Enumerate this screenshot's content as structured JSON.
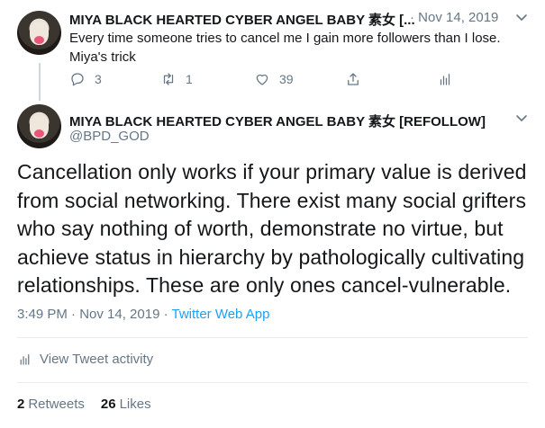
{
  "parent_tweet": {
    "display_name": "MIYA BLACK HEARTED CYBER ANGEL BABY 素女 [...",
    "date": "· Nov 14, 2019",
    "text_line1": "Every time someone tries to cancel me I gain more followers than I lose.",
    "text_line2": "Miya's trick",
    "replies": "3",
    "retweets": "1",
    "likes": "39"
  },
  "main_tweet": {
    "display_name": "MIYA BLACK HEARTED CYBER ANGEL BABY 素女 [REFOLLOW]",
    "handle": "@BPD_GOD",
    "text": "Cancellation only works if your primary value is derived from social networking. There exist many social grifters who say nothing of worth, demonstrate no virtue, but achieve status in hierarchy by pathologically cultivating relationships. These are only ones cancel-vulnerable.",
    "timestamp": "3:49 PM · Nov 14, 2019 · ",
    "source": "Twitter Web App",
    "activity_label": "View Tweet activity",
    "retweets_count": "2",
    "retweets_label": "Retweets",
    "likes_count": "26",
    "likes_label": "Likes"
  },
  "icons": {
    "reply": "reply-icon",
    "retweet": "retweet-icon",
    "like": "heart-icon",
    "share": "share-icon",
    "analytics": "analytics-icon",
    "more": "chevron-down-icon"
  },
  "colors": {
    "text": "#14171a",
    "secondary": "#657786",
    "link": "#1da1f2",
    "divider": "#e6ecf0"
  }
}
